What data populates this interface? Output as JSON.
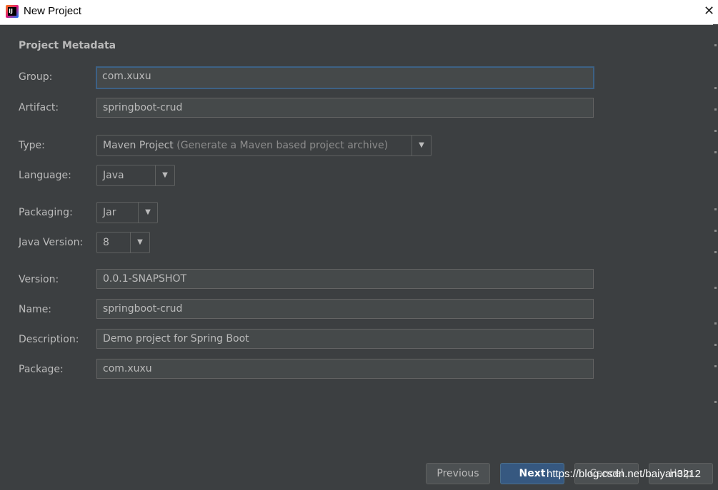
{
  "window": {
    "title": "New Project",
    "icon": "intellij-idea-icon",
    "close_glyph": "✕"
  },
  "section_title": "Project Metadata",
  "fields": {
    "group": {
      "label": "Group:",
      "value": "com.xuxu"
    },
    "artifact": {
      "label": "Artifact:",
      "value": "springboot-crud"
    },
    "version": {
      "label": "Version:",
      "value": "0.0.1-SNAPSHOT"
    },
    "name": {
      "label": "Name:",
      "value": "springboot-crud"
    },
    "description": {
      "label": "Description:",
      "value": "Demo project for Spring Boot"
    },
    "package": {
      "label": "Package:",
      "value": "com.xuxu"
    }
  },
  "selects": {
    "type": {
      "label": "Type:",
      "value": "Maven Project",
      "hint": "(Generate a Maven based project archive)"
    },
    "language": {
      "label": "Language:",
      "value": "Java"
    },
    "packaging": {
      "label": "Packaging:",
      "value": "Jar"
    },
    "java_version": {
      "label": "Java Version:",
      "value": "8"
    }
  },
  "buttons": {
    "previous": "Previous",
    "next": "Next",
    "cancel": "Cancel",
    "help": "Help"
  },
  "watermark": "https://blog.csdn.net/baiyan3212",
  "colors": {
    "background": "#3c3f41",
    "field_bg": "#45494a",
    "focus_border": "#3d6185",
    "primary_button": "#365880",
    "text": "#bbbbbb"
  }
}
